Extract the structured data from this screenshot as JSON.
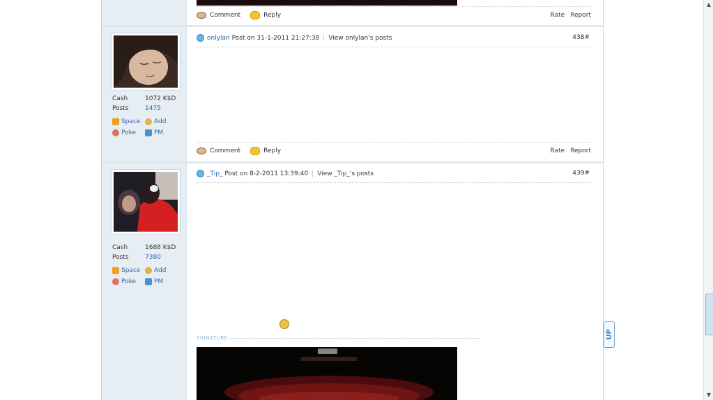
{
  "post_top": {
    "footer": {
      "comment": "Comment",
      "reply": "Reply",
      "rate": "Rate",
      "report": "Report"
    }
  },
  "post438": {
    "username": "onlylan",
    "post_on": "Post on 31-1-2011 21:27:38",
    "view_posts": "View onlylan's posts",
    "floor": "438#",
    "cash_label": "Cash",
    "cash_value": "1072 K$D",
    "posts_label": "Posts",
    "posts_value": "1475",
    "space": "Space",
    "add": "Add",
    "poke": "Poke",
    "pm": "PM",
    "footer": {
      "comment": "Comment",
      "reply": "Reply",
      "rate": "Rate",
      "report": "Report"
    }
  },
  "post439": {
    "username": "_Tip_",
    "post_on": "Post on 8-2-2011 13:39:40",
    "view_posts": "View _Tip_'s posts",
    "floor": "439#",
    "cash_label": "Cash",
    "cash_value": "1688 K$D",
    "posts_label": "Posts",
    "posts_value": "7380",
    "space": "Space",
    "add": "Add",
    "poke": "Poke",
    "pm": "PM",
    "signature_label": "SIGNATURE"
  },
  "up_button": "UP",
  "colors": {
    "link": "#3366aa",
    "sidebar": "#e6edf3",
    "signature": "#8cb8d8"
  }
}
